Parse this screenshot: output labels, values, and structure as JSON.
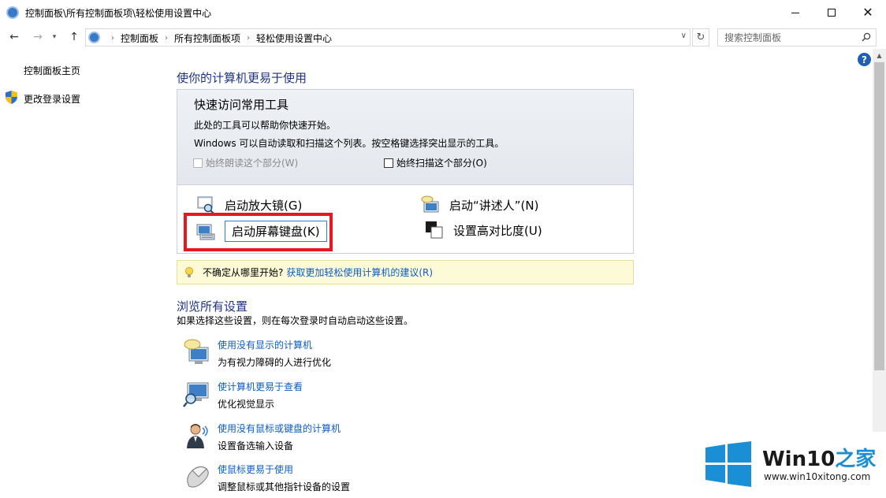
{
  "window": {
    "title": "控制面板\\所有控制面板项\\轻松使用设置中心",
    "minimize_icon": "minimize-icon",
    "maximize_icon": "maximize-icon",
    "close_icon": "close-icon"
  },
  "address": {
    "breadcrumbs": [
      "控制面板",
      "所有控制面板项",
      "轻松使用设置中心"
    ],
    "search_placeholder": "搜索控制面板"
  },
  "sidebar": {
    "home_label": "控制面板主页",
    "login_label": "更改登录设置"
  },
  "main": {
    "heading": "使你的计算机更易于使用",
    "quick_access": {
      "title": "快速访问常用工具",
      "desc1": "此处的工具可以帮助你快速开始。",
      "desc2": "Windows 可以自动读取和扫描这个列表。按空格键选择突出显示的工具。",
      "checkbox_read": "始终朗读这个部分(W)",
      "checkbox_scan": "始终扫描这个部分(O)",
      "tools": {
        "magnifier": "启动放大镜(G)",
        "keyboard": "启动屏幕键盘(K)",
        "narrator": "启动“讲述人”(N)",
        "contrast": "设置高对比度(U)"
      }
    },
    "tip": {
      "prefix": "不确定从哪里开始?",
      "link": "获取更加轻松使用计算机的建议(R)"
    },
    "browse": {
      "heading": "浏览所有设置",
      "desc": "如果选择这些设置，则在每次登录时自动启动这些设置。",
      "items": [
        {
          "link": "使用没有显示的计算机",
          "desc": "为有视力障碍的人进行优化"
        },
        {
          "link": "使计算机更易于查看",
          "desc": "优化视觉显示"
        },
        {
          "link": "使用没有鼠标或键盘的计算机",
          "desc": "设置备选输入设备"
        },
        {
          "link": "使鼠标更易于使用",
          "desc": "调整鼠标或其他指针设备的设置"
        }
      ]
    }
  },
  "watermark": {
    "title_main": "Win10",
    "title_accent": "之家",
    "url": "www.win10xitong.com"
  },
  "colors": {
    "heading": "#1e3287",
    "link": "#0b5cc7",
    "highlight": "#e8171f",
    "tip_bg": "#fdfbd7"
  }
}
